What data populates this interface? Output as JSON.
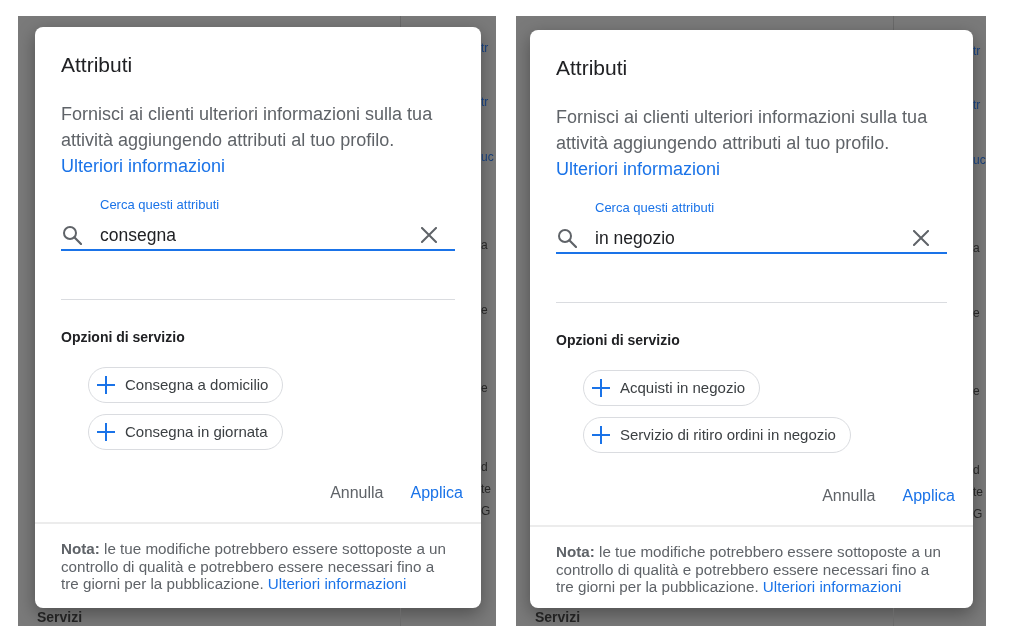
{
  "panels": [
    {
      "backdrop": {
        "edge_fragments": [
          {
            "text": "tr",
            "kind": "link"
          },
          {
            "text": "tr",
            "kind": "link"
          },
          {
            "text": "uc",
            "kind": "link"
          },
          {
            "text": "a",
            "kind": "text"
          },
          {
            "text": "e",
            "kind": "text"
          },
          {
            "text": "e",
            "kind": "text"
          },
          {
            "text": "d",
            "kind": "text"
          },
          {
            "text": "te",
            "kind": "text"
          },
          {
            "text": "G",
            "kind": "text"
          }
        ],
        "bottom_heading": "Servizi"
      },
      "dialog": {
        "title": "Attributi",
        "description": "Fornisci ai clienti ulteriori informazioni sulla tua attività aggiungendo attributi al tuo profilo.",
        "learn_more_link": "Ulteriori informazioni",
        "search": {
          "label": "Cerca questi attributi",
          "value": "consegna",
          "focused": true
        },
        "section_title": "Opzioni di servizio",
        "options": [
          {
            "label": "Consegna a domicilio"
          },
          {
            "label": "Consegna in giornata"
          }
        ],
        "actions": [
          {
            "label": "Annulla",
            "kind": "secondary"
          },
          {
            "label": "Applica",
            "kind": "primary"
          }
        ],
        "note": {
          "text": "**Nota:** le tue modifiche potrebbero essere sottoposte a un controllo di qualità e potrebbero essere necessari fino a tre giorni per la pubblicazione.",
          "link": "Ulteriori informazioni"
        }
      }
    },
    {
      "backdrop": {
        "edge_fragments": [
          {
            "text": "tr",
            "kind": "link"
          },
          {
            "text": "tr",
            "kind": "link"
          },
          {
            "text": "uc",
            "kind": "link"
          },
          {
            "text": "a",
            "kind": "text"
          },
          {
            "text": "e",
            "kind": "text"
          },
          {
            "text": "e",
            "kind": "text"
          },
          {
            "text": "d",
            "kind": "text"
          },
          {
            "text": "te",
            "kind": "text"
          },
          {
            "text": "G",
            "kind": "text"
          }
        ],
        "bottom_heading": "Servizi"
      },
      "dialog": {
        "title": "Attributi",
        "description": "Fornisci ai clienti ulteriori informazioni sulla tua attività aggiungendo attributi al tuo profilo.",
        "learn_more_link": "Ulteriori informazioni",
        "search": {
          "label": "Cerca questi attributi",
          "value": "in negozio",
          "focused": true
        },
        "section_title": "Opzioni di servizio",
        "options": [
          {
            "label": "Acquisti in negozio"
          },
          {
            "label": "Servizio di ritiro ordini in negozio"
          }
        ],
        "actions": [
          {
            "label": "Annulla",
            "kind": "secondary"
          },
          {
            "label": "Applica",
            "kind": "primary"
          }
        ],
        "note": {
          "text": "**Nota:** le tue modifiche potrebbero essere sottoposte a un controllo di qualità e potrebbero essere necessari fino a tre giorni per la pubblicazione.",
          "link": "Ulteriori informazioni"
        }
      }
    }
  ]
}
